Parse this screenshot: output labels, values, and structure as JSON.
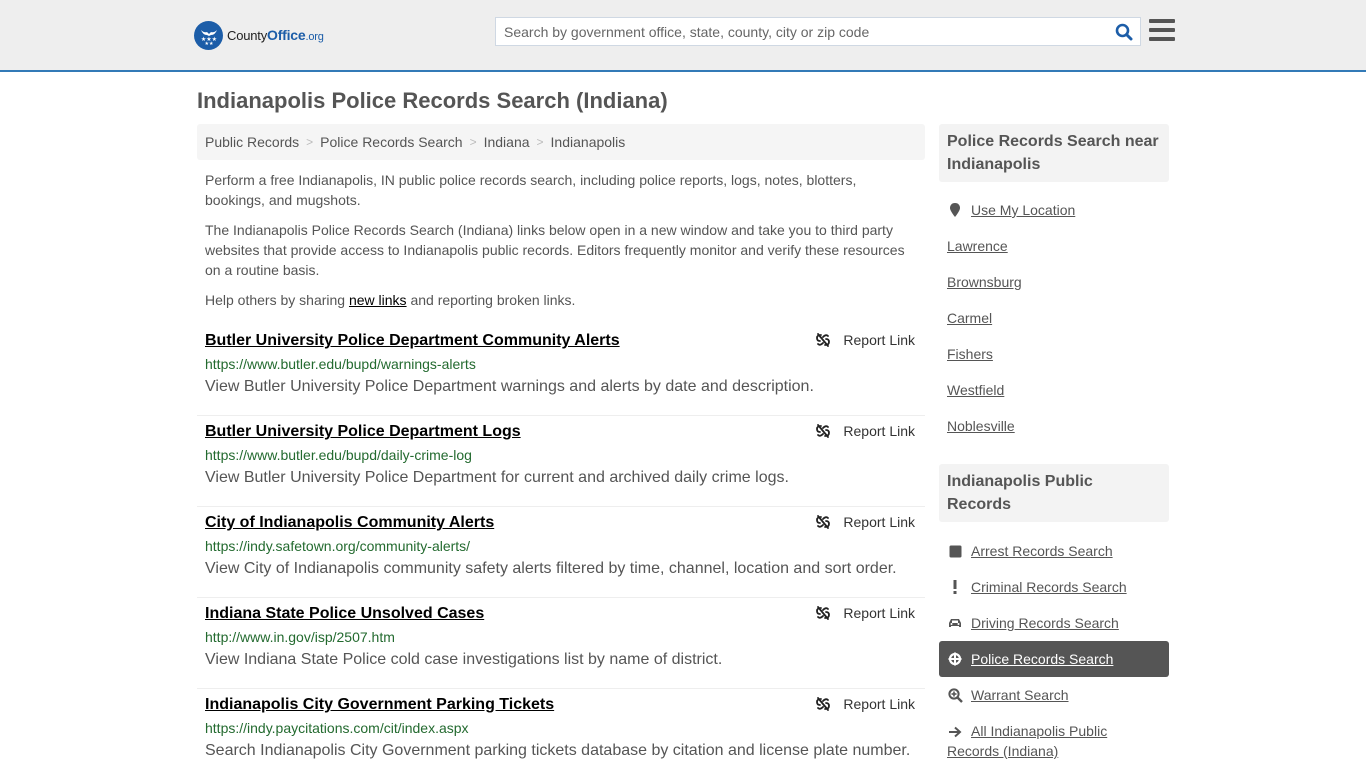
{
  "header": {
    "logo_name": "County",
    "logo_office": "Office",
    "logo_tld": ".org",
    "search_placeholder": "Search by government office, state, county, city or zip code",
    "search_value": ""
  },
  "page": {
    "title": "Indianapolis Police Records Search (Indiana)",
    "breadcrumb": [
      "Public Records",
      "Police Records Search",
      "Indiana",
      "Indianapolis"
    ],
    "intro_1": "Perform a free Indianapolis, IN public police records search, including police reports, logs, notes, blotters, bookings, and mugshots.",
    "intro_2": "The Indianapolis Police Records Search (Indiana) links below open in a new window and take you to third party websites that provide access to Indianapolis public records. Editors frequently monitor and verify these resources on a routine basis.",
    "intro_3_before": "Help others by sharing ",
    "intro_3_link": "new links",
    "intro_3_after": " and reporting broken links."
  },
  "results": [
    {
      "title": "Butler University Police Department Community Alerts",
      "url": "https://www.butler.edu/bupd/warnings-alerts",
      "description": "View Butler University Police Department warnings and alerts by date and description.",
      "report_label": "Report Link"
    },
    {
      "title": "Butler University Police Department Logs",
      "url": "https://www.butler.edu/bupd/daily-crime-log",
      "description": "View Butler University Police Department for current and archived daily crime logs.",
      "report_label": "Report Link"
    },
    {
      "title": "City of Indianapolis Community Alerts",
      "url": "https://indy.safetown.org/community-alerts/",
      "description": "View City of Indianapolis community safety alerts filtered by time, channel, location and sort order.",
      "report_label": "Report Link"
    },
    {
      "title": "Indiana State Police Unsolved Cases",
      "url": "http://www.in.gov/isp/2507.htm",
      "description": "View Indiana State Police cold case investigations list by name of district.",
      "report_label": "Report Link"
    },
    {
      "title": "Indianapolis City Government Parking Tickets",
      "url": "https://indy.paycitations.com/cit/index.aspx",
      "description": "Search Indianapolis City Government parking tickets database by citation and license plate number.",
      "report_label": "Report Link"
    }
  ],
  "sidebar": {
    "nearby_title": "Police Records Search near Indianapolis",
    "use_location": "Use My Location",
    "nearby": [
      "Lawrence",
      "Brownsburg",
      "Carmel",
      "Fishers",
      "Westfield",
      "Noblesville"
    ],
    "public_title": "Indianapolis Public Records",
    "public_links": [
      {
        "label": "Arrest Records Search",
        "icon": "square-icon"
      },
      {
        "label": "Criminal Records Search",
        "icon": "exclamation-icon"
      },
      {
        "label": "Driving Records Search",
        "icon": "car-icon"
      },
      {
        "label": "Police Records Search",
        "icon": "crosshair-icon",
        "active": true
      },
      {
        "label": "Warrant Search",
        "icon": "zoom-in-icon"
      },
      {
        "label": "All Indianapolis Public Records (Indiana)",
        "icon": "arrow-right-icon"
      }
    ]
  },
  "colors": {
    "accent_blue": "#337ab7",
    "logo_blue": "#1c5da8",
    "url_green": "#236a2f",
    "active_bg": "#555555"
  }
}
